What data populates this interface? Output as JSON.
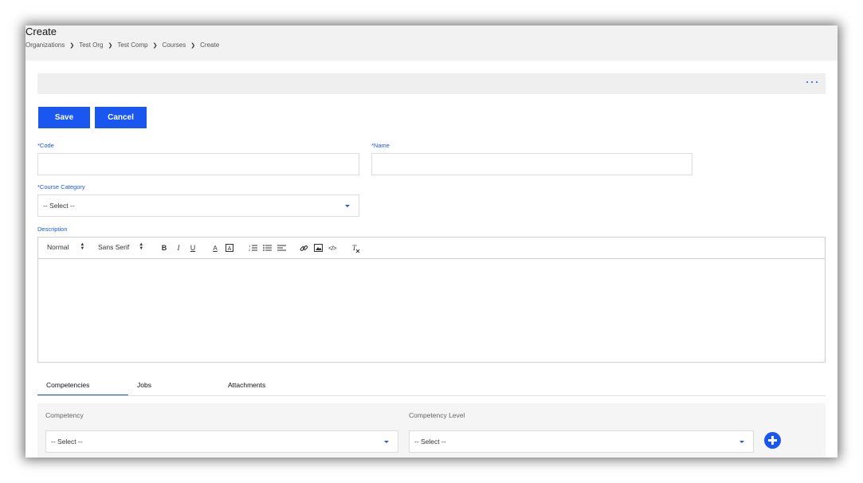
{
  "page": {
    "title": "Create",
    "breadcrumb": [
      "Organizations",
      "Test Org",
      "Test Comp",
      "Courses",
      "Create"
    ]
  },
  "actions": {
    "save_label": "Save",
    "cancel_label": "Cancel"
  },
  "form": {
    "code": {
      "label": "*Code",
      "value": ""
    },
    "name": {
      "label": "*Name",
      "value": ""
    },
    "course_category": {
      "label": "*Course Category",
      "selected": "-- Select --"
    },
    "description": {
      "label": "Description",
      "toolbar": {
        "heading_select": "Normal",
        "font_select": "Sans Serif"
      },
      "value": ""
    }
  },
  "tabs": [
    {
      "label": "Competencies",
      "active": true
    },
    {
      "label": "Jobs",
      "active": false
    },
    {
      "label": "Attachments",
      "active": false
    }
  ],
  "competencies": {
    "competency_label": "Competency",
    "competency_selected": "-- Select --",
    "level_label": "Competency Level",
    "level_selected": "-- Select --"
  },
  "colors": {
    "accent": "#1a56f0",
    "header_bg": "#f2f2f2"
  }
}
